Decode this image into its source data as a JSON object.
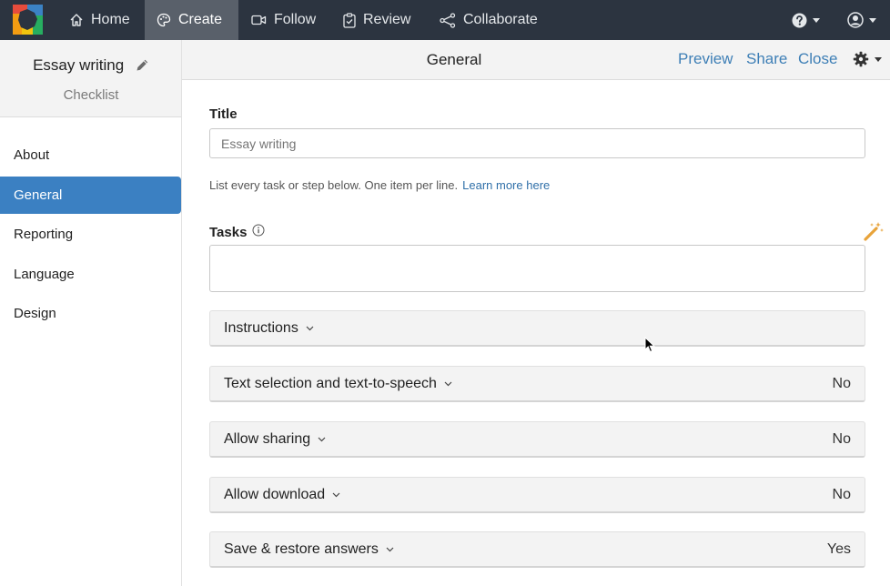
{
  "nav": {
    "items": [
      {
        "label": "Home",
        "icon": "home-icon"
      },
      {
        "label": "Create",
        "icon": "palette-icon",
        "active": true
      },
      {
        "label": "Follow",
        "icon": "video-icon"
      },
      {
        "label": "Review",
        "icon": "clipboard-icon"
      },
      {
        "label": "Collaborate",
        "icon": "share-nodes-icon"
      }
    ],
    "help_icon": "help-circle-icon",
    "user_icon": "user-circle-icon"
  },
  "sidebar": {
    "project_title": "Essay writing",
    "project_type": "Checklist",
    "items": [
      {
        "label": "About"
      },
      {
        "label": "General",
        "active": true
      },
      {
        "label": "Reporting"
      },
      {
        "label": "Language"
      },
      {
        "label": "Design"
      }
    ]
  },
  "header": {
    "title": "General",
    "preview": "Preview",
    "share": "Share",
    "close": "Close"
  },
  "form": {
    "title_label": "Title",
    "title_placeholder": "Essay writing",
    "hint_text": "List every task or step below. One item per line.",
    "hint_link": "Learn more here",
    "tasks_label": "Tasks"
  },
  "sections": [
    {
      "label": "Instructions",
      "value": ""
    },
    {
      "label": "Text selection and text-to-speech",
      "value": "No"
    },
    {
      "label": "Allow sharing",
      "value": "No"
    },
    {
      "label": "Allow download",
      "value": "No"
    },
    {
      "label": "Save & restore answers",
      "value": "Yes"
    }
  ],
  "colors": {
    "topbar": "#2c3440",
    "accent": "#3b80c2",
    "link": "#3e7fb6",
    "wand": "#e8a33a"
  }
}
